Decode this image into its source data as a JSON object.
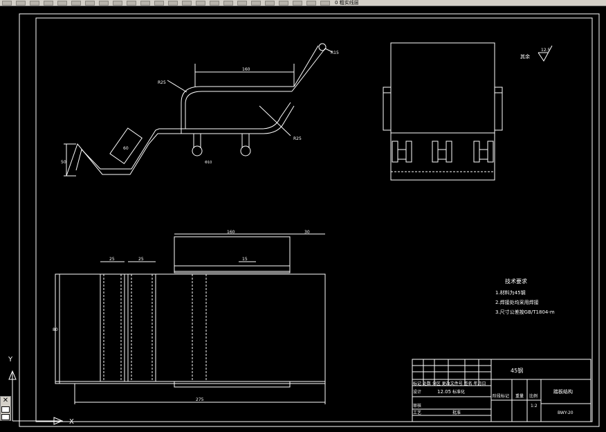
{
  "toolbar": {
    "layer_name": "0 粗实线层",
    "icons": [
      "new-icon",
      "open-icon",
      "save-icon",
      "print-icon",
      "preview-icon",
      "plot-icon",
      "cut-icon",
      "copy-icon",
      "paste-icon",
      "matchprop-icon",
      "undo-icon",
      "redo-icon",
      "pan-icon",
      "zoom-realtime-icon",
      "zoom-window-icon",
      "zoom-previous-icon",
      "properties-icon",
      "designcenter-icon",
      "toolpalette-icon",
      "sheetset-icon",
      "markup-icon",
      "calculator-icon",
      "layer-manager-icon",
      "layer-state-icon"
    ]
  },
  "drawing": {
    "side_view_dims": {
      "top_length": "160",
      "r_left": "R25",
      "r_right_top": "R15",
      "r_right_bottom": "R25",
      "slope_len": "60",
      "height": "50",
      "wheel_dia": "Φ10",
      "wheel_dia2": "Φ10"
    },
    "roughness": {
      "label": "其余",
      "value": "12.5"
    },
    "plan_view_dims": {
      "top_width": "160",
      "top_offset": "30",
      "slot1": "25",
      "slot2": "25",
      "hole": "15",
      "height": "80",
      "total_width": "275"
    },
    "tech_requirements": {
      "title": "技术要求",
      "items": [
        "1.材料为45钢",
        "2.焊接处均采用焊接",
        "3.尺寸公差按GB/T1804-m"
      ]
    },
    "title_block": {
      "material": "45钢",
      "part_name": "踏板结构",
      "drawing_no": "BWY-20",
      "row_header": "标记 处数 分区 更改文件号 签名 年月日",
      "designer_label": "设计",
      "date_value": "12.05",
      "standardize": "标准化",
      "stage_label": "阶段标记",
      "weight_label": "重量",
      "scale_label": "比例",
      "scale_value": "1:2",
      "review_label": "审核",
      "process_label": "工艺",
      "approve_label": "批准"
    },
    "ucs": {
      "x_label": "X",
      "y_label": "Y"
    }
  }
}
